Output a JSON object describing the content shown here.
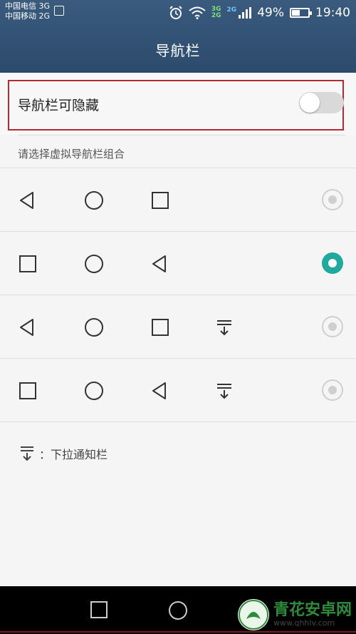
{
  "status_bar": {
    "carrier1": "中国电信 3G",
    "carrier2": "中国移动 2G",
    "net_tag_a": "3G",
    "net_tag_b": "2G",
    "net_tag_c": "2G",
    "battery": "49%",
    "battery_level": 0.49,
    "time": "19:40",
    "icons": [
      "image-icon",
      "alarm-icon",
      "wifi-icon",
      "signal-icon",
      "battery-icon"
    ]
  },
  "header": {
    "title": "导航栏"
  },
  "toggle": {
    "label": "导航栏可隐藏",
    "state": "off"
  },
  "section": {
    "title": "请选择虚拟导航栏组合"
  },
  "combos": [
    {
      "buttons": [
        "back",
        "home",
        "recent"
      ],
      "selected": false
    },
    {
      "buttons": [
        "recent",
        "home",
        "back"
      ],
      "selected": true
    },
    {
      "buttons": [
        "back",
        "home",
        "recent",
        "notification"
      ],
      "selected": false
    },
    {
      "buttons": [
        "recent",
        "home",
        "back",
        "notification"
      ],
      "selected": false
    }
  ],
  "legend": {
    "label": "：下拉通知栏",
    "icon": "notification-pull-down-icon"
  },
  "system_nav": {
    "buttons": [
      "recent",
      "home"
    ]
  },
  "watermark": {
    "name": "青花安卓网",
    "url": "www.qhhlv.com"
  },
  "colors": {
    "header": "#2c4b6c",
    "accent": "#21a9a0",
    "highlight": "#b52a33"
  }
}
